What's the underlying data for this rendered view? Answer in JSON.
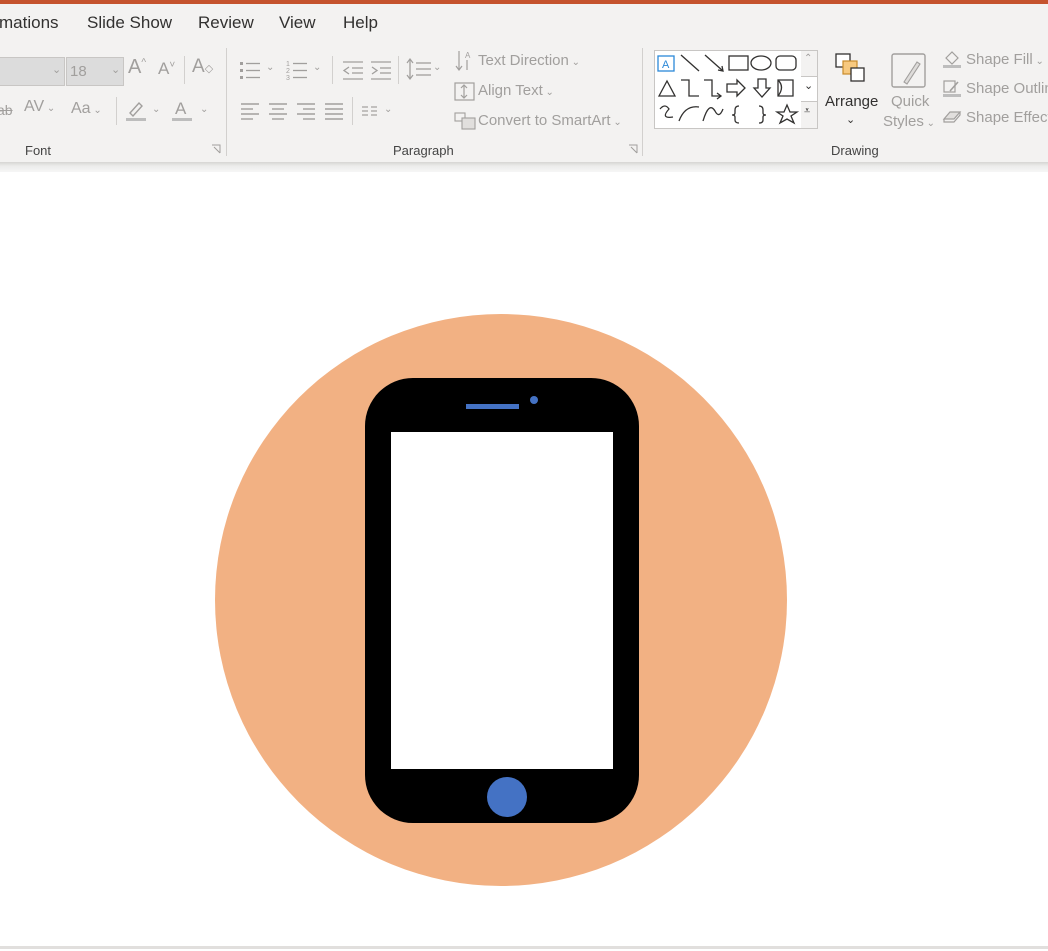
{
  "menu": {
    "animations": "mations",
    "slide_show": "Slide Show",
    "review": "Review",
    "view": "View",
    "help": "Help"
  },
  "font_group": {
    "label": "Font",
    "font_size": "18",
    "change_case": "Aa",
    "spacing": "AV"
  },
  "paragraph_group": {
    "label": "Paragraph",
    "text_direction": "Text Direction",
    "align_text": "Align Text",
    "convert_smartart": "Convert to SmartArt"
  },
  "drawing_group": {
    "label": "Drawing",
    "arrange": "Arrange",
    "quick_styles_1": "Quick",
    "quick_styles_2": "Styles",
    "shape_fill": "Shape Fill",
    "shape_outline": "Shape Outlin",
    "shape_effects": "Shape Effect"
  },
  "colors": {
    "accent": "#c5532e",
    "circle": "#f2b183",
    "phone_body": "#000000",
    "phone_screen": "#ffffff",
    "phone_detail": "#4472c4"
  },
  "icons": [
    "font-grow-icon",
    "font-shrink-icon",
    "clear-format-icon",
    "bullets-icon",
    "numbering-icon",
    "decrease-indent-icon",
    "increase-indent-icon",
    "line-spacing-icon",
    "align-left-icon",
    "align-center-icon",
    "align-right-icon",
    "justify-icon",
    "columns-icon",
    "highlight-icon",
    "font-color-icon",
    "arrange-icon",
    "quick-styles-icon",
    "shape-fill-icon",
    "shape-outline-icon",
    "shape-effects-icon"
  ]
}
